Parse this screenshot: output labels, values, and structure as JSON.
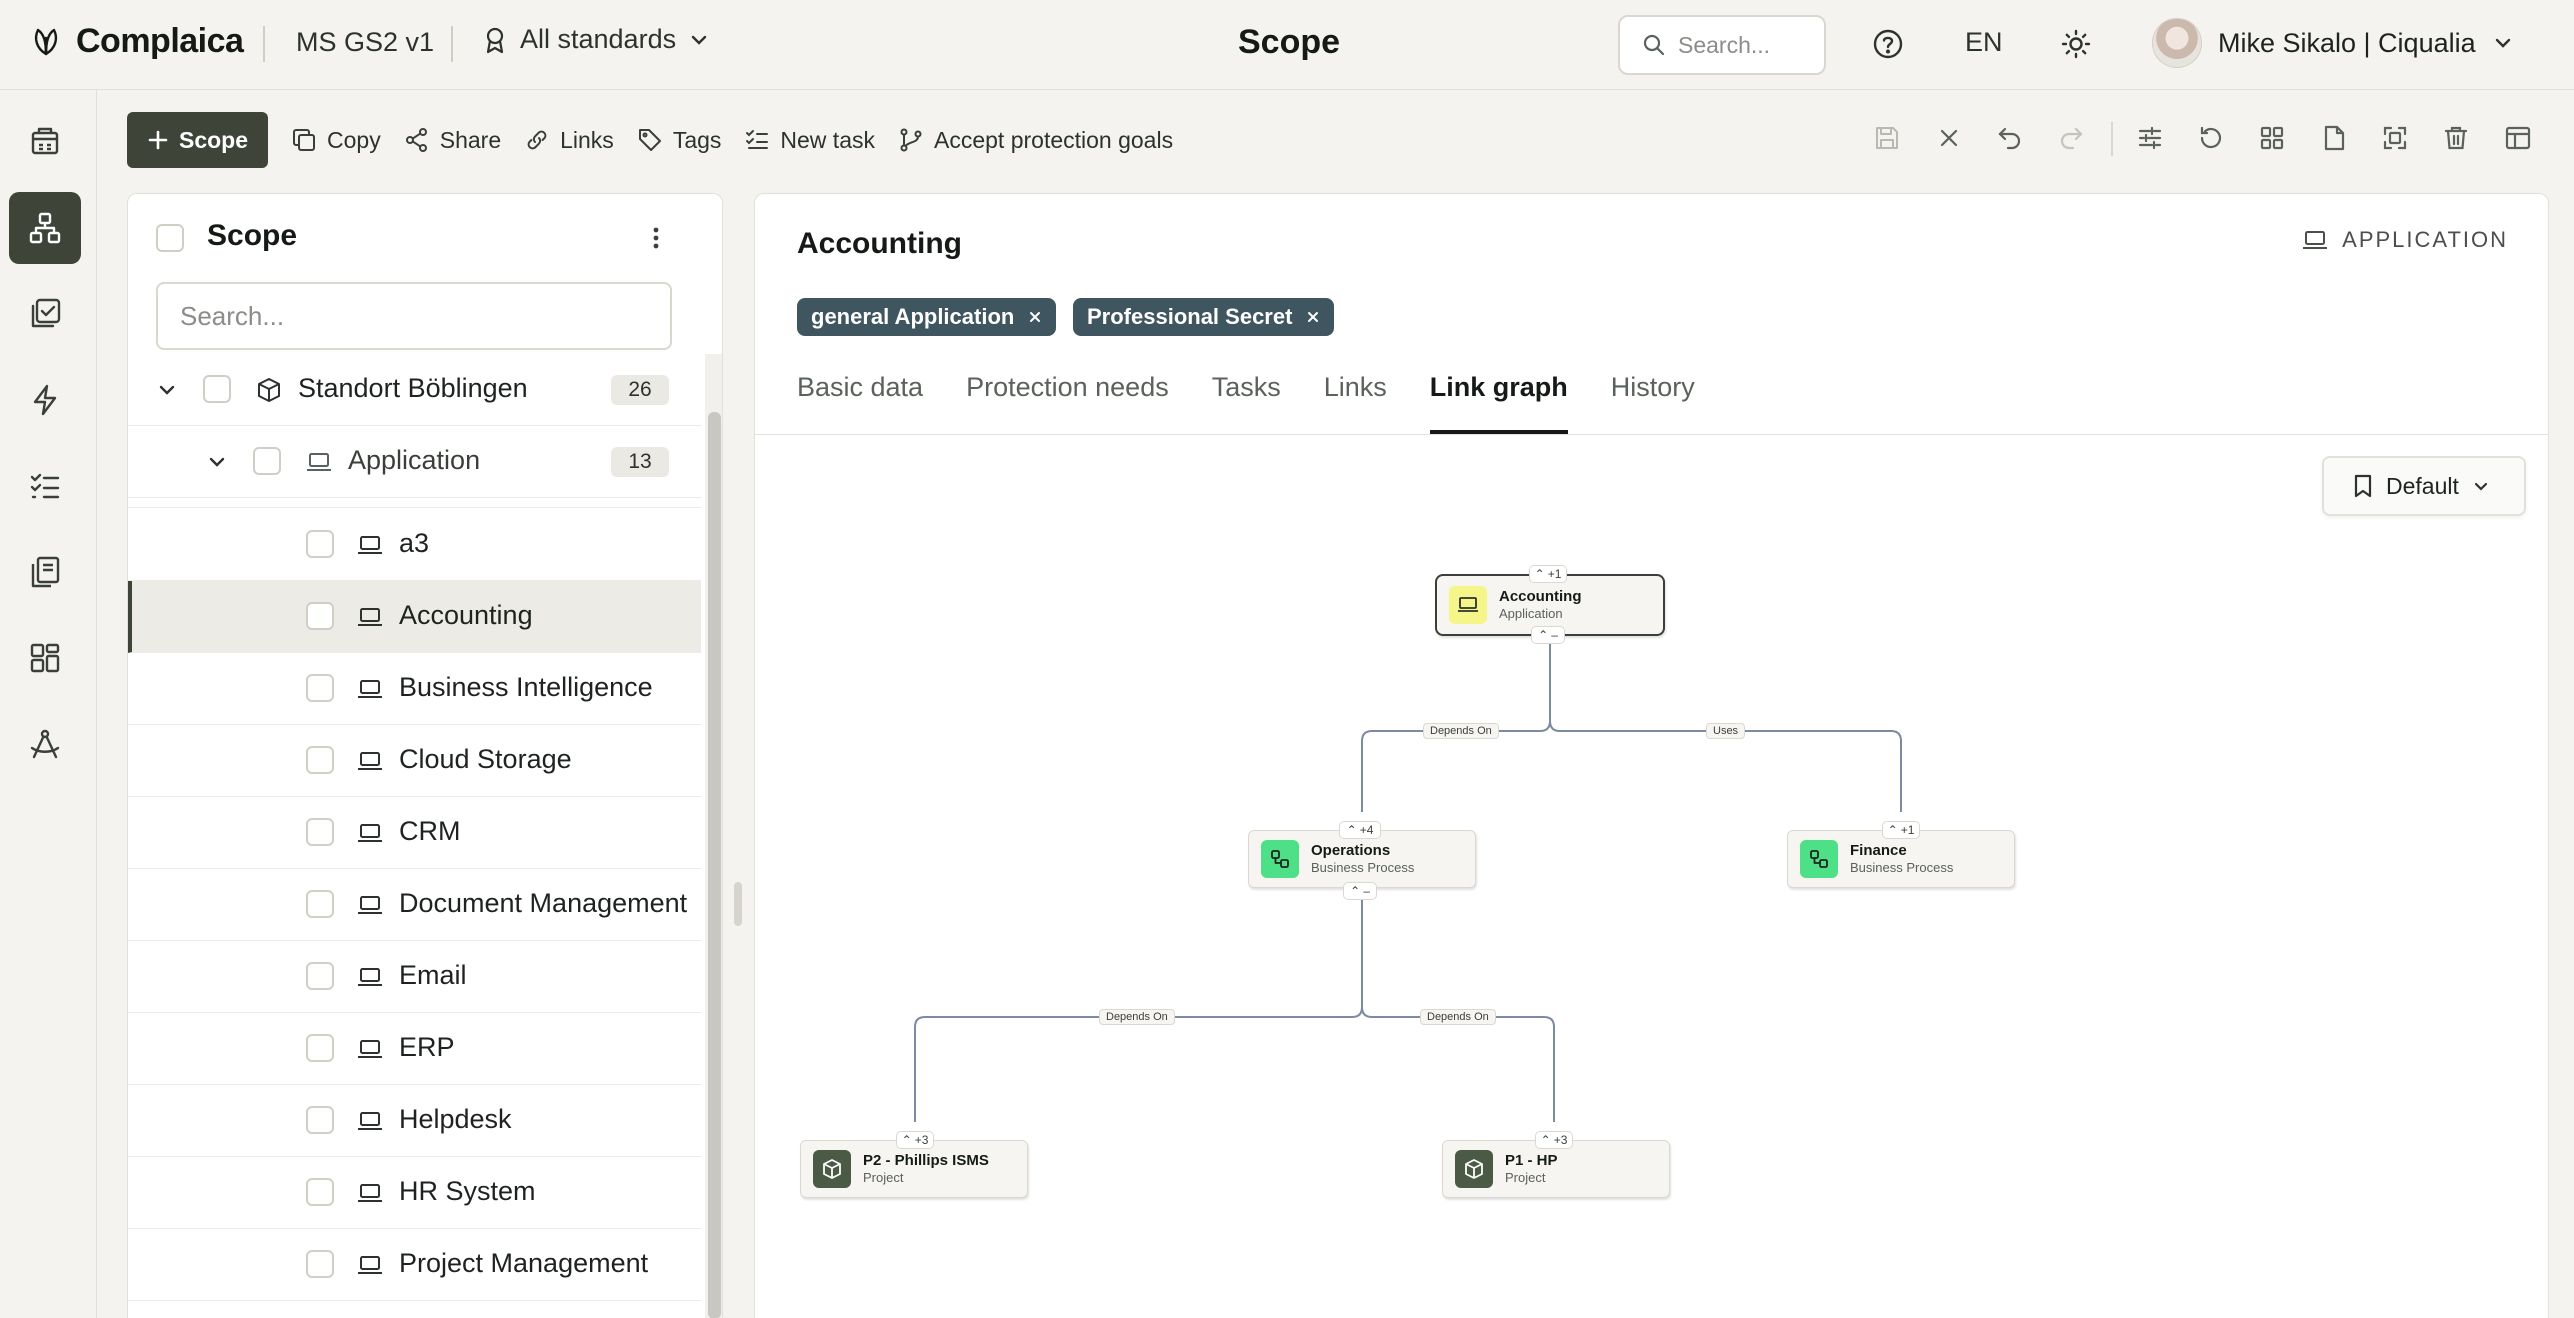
{
  "app": {
    "brand": "Complaica",
    "version_label": "MS GS2 v1",
    "standards_label": "All standards",
    "page_title": "Scope",
    "search_placeholder": "Search...",
    "language": "EN",
    "user_name": "Mike Sikalo | Ciqualia"
  },
  "rail": {
    "items": [
      "dashboard-icon",
      "hierarchy-icon",
      "checklist-icon",
      "bolt-icon",
      "tasks-icon",
      "library-icon",
      "grid-icon",
      "compass-icon"
    ],
    "active_index": 1
  },
  "toolbar": {
    "scope_label": "Scope",
    "copy_label": "Copy",
    "share_label": "Share",
    "links_label": "Links",
    "tags_label": "Tags",
    "new_task_label": "New task",
    "accept_label": "Accept protection goals"
  },
  "left_panel": {
    "title": "Scope",
    "search_placeholder": "Search...",
    "root": {
      "label": "Standort Böblingen",
      "count": "26"
    },
    "group": {
      "label": "Application",
      "count": "13"
    },
    "items": [
      "a3",
      "Accounting",
      "Business Intelligence",
      "Cloud Storage",
      "CRM",
      "Document Management",
      "Email",
      "ERP",
      "Helpdesk",
      "HR System",
      "Project Management"
    ],
    "selected_index": 1
  },
  "detail": {
    "title": "Accounting",
    "type_label": "APPLICATION",
    "tags": [
      "general Application",
      "Professional Secret"
    ],
    "tabs": [
      "Basic data",
      "Protection needs",
      "Tasks",
      "Links",
      "Link graph",
      "History"
    ],
    "active_tab": 4,
    "view_label": "Default"
  },
  "graph": {
    "nodes": {
      "accounting": {
        "name": "Accounting",
        "type": "Application",
        "up": "+1",
        "down": "–"
      },
      "operations": {
        "name": "Operations",
        "type": "Business Process",
        "up": "+4",
        "down": "–"
      },
      "finance": {
        "name": "Finance",
        "type": "Business Process",
        "up": "+1"
      },
      "p2": {
        "name": "P2 - Phillips ISMS",
        "type": "Project",
        "up": "+3"
      },
      "p1": {
        "name": "P1 - HP",
        "type": "Project",
        "up": "+3"
      }
    },
    "edges": {
      "acc_ops": "Depends On",
      "acc_fin": "Uses",
      "ops_p2": "Depends On",
      "ops_p1": "Depends On"
    },
    "colors": {
      "application": "#f5f58a",
      "business_process": "#4ee086",
      "project": "#4a5a44",
      "edge": "#7c8ba3"
    }
  }
}
